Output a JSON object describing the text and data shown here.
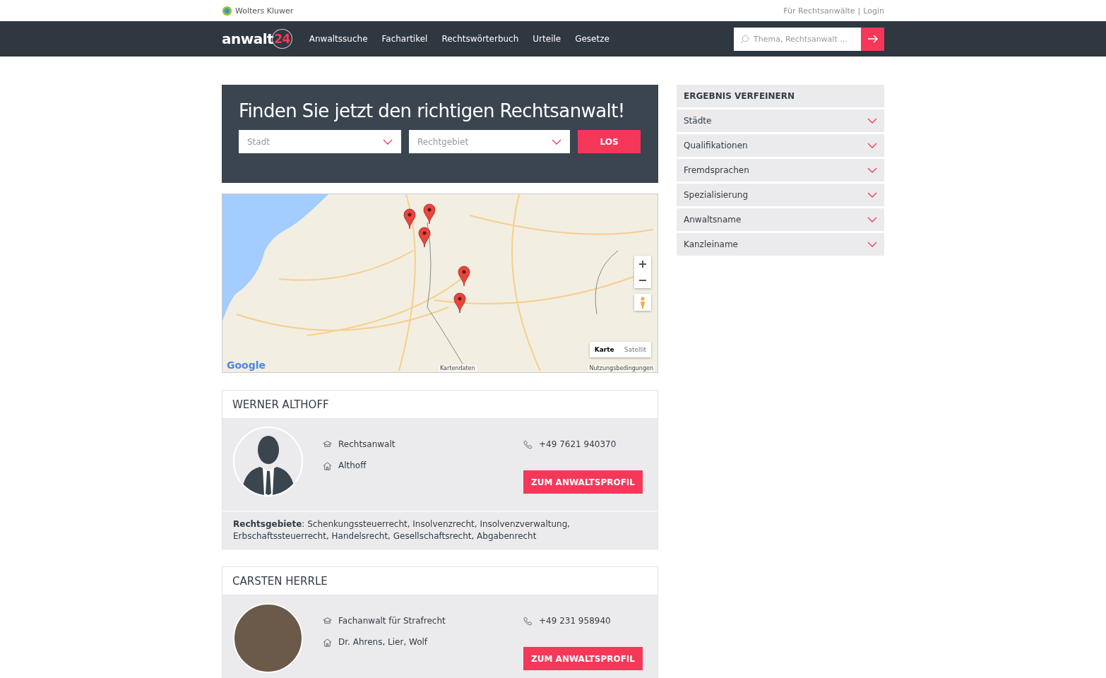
{
  "topbar": {
    "brand": "Wolters Kluwer",
    "links": [
      "Für Rechtsanwälte",
      "Login"
    ],
    "separator": "|"
  },
  "nav": {
    "logo": {
      "text": "anwalt",
      "accent": "24"
    },
    "items": [
      "Anwaltssuche",
      "Fachartikel",
      "Rechtswörterbuch",
      "Urteile",
      "Gesetze"
    ],
    "search": {
      "placeholder": "Thema, Rechtsanwalt ..."
    }
  },
  "hero": {
    "title": "Finden Sie jetzt den richtigen Rechtsanwalt!",
    "selects": [
      {
        "placeholder": "Stadt"
      },
      {
        "placeholder": "Rechtgebiet"
      }
    ],
    "button": "LOS"
  },
  "map": {
    "map_types": [
      {
        "label": "Karte",
        "selected": true
      },
      {
        "label": "Satellit",
        "selected": false
      }
    ],
    "attribution": "Google",
    "data_label": "Kartendaten",
    "terms": "Nutzungsbedingungen"
  },
  "results": [
    {
      "name": "WERNER ALTHOFF",
      "kind": "silhouette",
      "title": "Rechtsanwalt",
      "firm": "Althoff",
      "phone": "+49 7621 940370",
      "button": "ZUM ANWALTSPROFIL",
      "areas": "**Rechtsgebiete**: Schenkungssteuerrecht, Insolvenzrecht, Insolvenzverwaltung, Erbschaftssteuerrecht, Handelsrecht, Gesellschaftsrecht, Abgabenrecht"
    },
    {
      "name": "CARSTEN HERRLE",
      "kind": "photo",
      "title": "Fachanwalt für Strafrecht",
      "firm": "Dr. Ahrens, Lier, Wolf",
      "phone": "+49 231 958940",
      "button": "ZUM ANWALTSPROFIL"
    }
  ],
  "sidebar": {
    "title": "ERGEBNIS VERFEINERN",
    "filters": [
      {
        "label": "Städte",
        "expanded": false
      },
      {
        "label": "Qualifikationen",
        "expanded": false
      },
      {
        "label": "Fremdsprachen",
        "expanded": false
      },
      {
        "label": "Spezialisierung",
        "expanded": false
      },
      {
        "label": "Anwaltsname",
        "expanded": false
      },
      {
        "label": "Kanzleiname",
        "expanded": false
      }
    ]
  }
}
